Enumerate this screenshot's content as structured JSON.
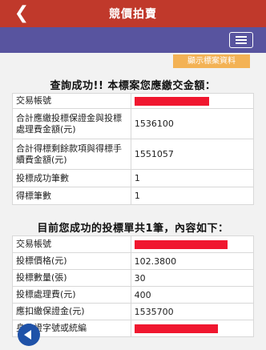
{
  "appbar": {
    "title": "競價拍賣",
    "back_icon": "chevron-left-icon"
  },
  "navbar": {
    "menu_icon": "hamburger-menu-icon"
  },
  "tag_button": {
    "label": "顯示標案資料"
  },
  "query": {
    "heading": "查詢成功!! 本標案您應繳交金額：",
    "rows": [
      {
        "label": "交易帳號",
        "value": ""
      },
      {
        "label": "合計應繳投標保證金與投標處理費金額(元)",
        "value": "1536100"
      },
      {
        "label": "合計得標剩餘款項與得標手續費金額(元)",
        "value": "1551057"
      },
      {
        "label": "投標成功筆數",
        "value": "1"
      },
      {
        "label": "得標筆數",
        "value": "1"
      }
    ]
  },
  "bids": {
    "heading": "目前您成功的投標單共1筆，內容如下：",
    "rows": [
      {
        "label": "交易帳號",
        "value": ""
      },
      {
        "label": "投標價格(元)",
        "value": "102.3800"
      },
      {
        "label": "投標數量(張)",
        "value": "30"
      },
      {
        "label": "投標處理費(元)",
        "value": "400"
      },
      {
        "label": "應扣繳保證金(元)",
        "value": "1535700"
      },
      {
        "label": "身分證字號或統編",
        "value": ""
      }
    ]
  },
  "colors": {
    "appbar": "#c0392b",
    "navbar": "#58549f",
    "accent": "#f3b255",
    "redaction": "#f0172f"
  },
  "fab_icon": "play-left-icon"
}
